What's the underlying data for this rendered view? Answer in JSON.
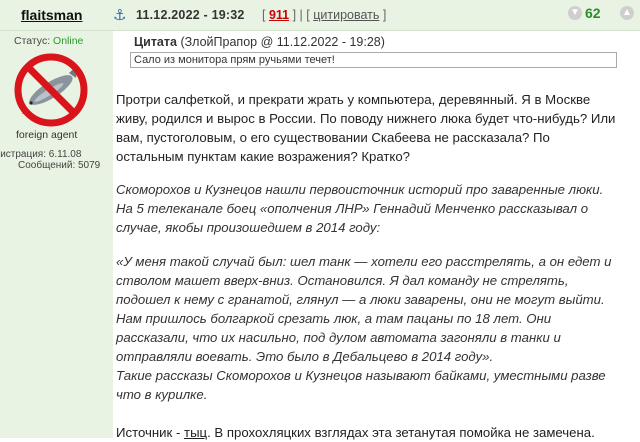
{
  "post": {
    "username": "flaitsman",
    "date": "11.12.2022 - 19:32",
    "post_number": "911",
    "quote_action": "цитировать",
    "rating": "62"
  },
  "user": {
    "status_label": "Статус:",
    "status_value": "Online",
    "title": "foreign agent",
    "registration": "егистрация: 6.11.08",
    "messages": "Сообщений: 5079"
  },
  "quote": {
    "label": "Цитата",
    "source": "(ЗлойПрапор @ 11.12.2022 - 19:28)",
    "text": "Сало из монитора прям ручьями течет!"
  },
  "body": {
    "p1": "Протри салфеткой, и прекрати жрать у компьютера, деревянный. Я в Москве живу, родился и вырос в России. По поводу нижнего люка будет что-нибудь? Или вам, пустоголовым, о его существовании Скабеева не рассказала? По остальным пунктам какие возражения? Кратко?",
    "p2": "Скоморохов и Кузнецов нашли первоисточник историй про заваренные люки. На 5 телеканале боец «ополчения ЛНР» Геннадий Менченко рассказывал о случае, якобы произошедшем в 2014 году:",
    "p3": "«У меня такой случай был: шел танк — хотели его расстрелять, а он едет и стволом машет вверх-вниз. Остановился. Я дал команду не стрелять, подошел к нему с гранатой, глянул — а люки заварены, они не могут выйти. Нам пришлось болгаркой срезать люк, а там пацаны по 18 лет. Они рассказали, что их насильно, под дулом автомата загоняли в танки и отправляли воевать. Это было в Дебальцево в 2014 году».\nТакие рассказы Скоморохов и Кузнецов называют байками, уместными разве что в курилке.",
    "p4_prefix": "Источник - ",
    "p4_link": "тыц",
    "p4_suffix": ". В прохохляцких взглядах эта зетанутая помойка не замечена."
  },
  "icons": {
    "anchor": "anchor-icon",
    "avatar": "no-fish-avatar",
    "vote_down": "vote-down-icon",
    "vote_up": "vote-up-icon"
  },
  "colors": {
    "header_bg": "#e8f3e4",
    "online": "#2b9b2b",
    "post_number": "#cc0000",
    "rating": "#2c8c2c"
  }
}
